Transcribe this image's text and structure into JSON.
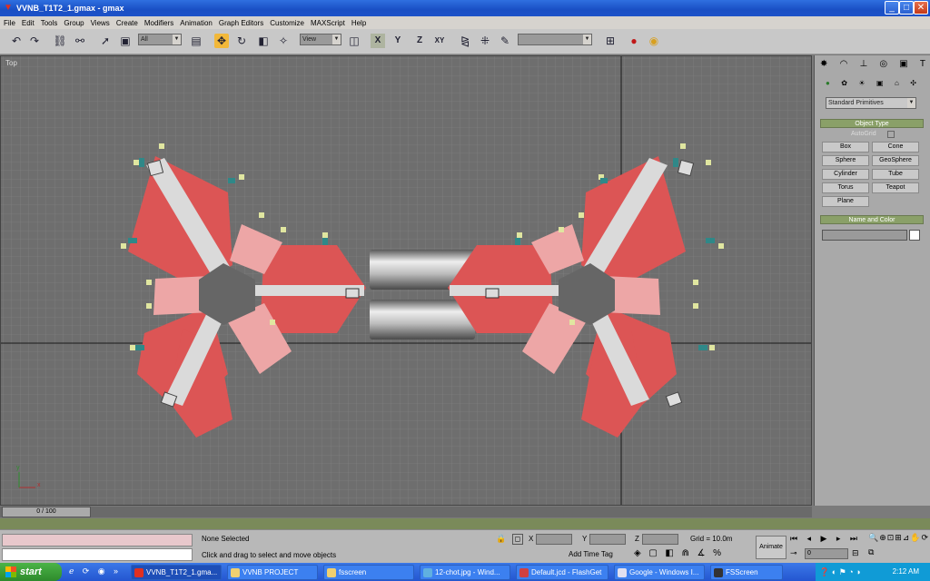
{
  "window": {
    "title": "VVNB_T1T2_1.gmax - gmax",
    "minimize": "_",
    "maximize": "□",
    "close": "✕"
  },
  "menu": [
    "File",
    "Edit",
    "Tools",
    "Group",
    "Views",
    "Create",
    "Modifiers",
    "Animation",
    "Graph Editors",
    "Customize",
    "MAXScript",
    "Help"
  ],
  "toolbar": {
    "selection_filter": "All",
    "coord_system": "View"
  },
  "viewport": {
    "label": "Top",
    "axis_x": "x",
    "axis_y": "y"
  },
  "command_panel": {
    "category": "Standard Primitives",
    "rollout_object_type": "Object Type",
    "autogrid": "AutoGrid",
    "buttons": [
      "Box",
      "Cone",
      "Sphere",
      "GeoSphere",
      "Cylinder",
      "Tube",
      "Torus",
      "Teapot",
      "Plane"
    ],
    "rollout_name_color": "Name and Color"
  },
  "timeline": {
    "slider": "0 / 100"
  },
  "status": {
    "selection": "None Selected",
    "prompt": "Click and drag to select and move objects",
    "x_label": "X",
    "y_label": "Y",
    "z_label": "Z",
    "grid": "Grid = 10.0m",
    "add_time_tag": "Add Time Tag",
    "animate": "Animate",
    "frame": "0"
  },
  "taskbar": {
    "start": "start",
    "tasks": [
      "VVNB_T1T2_1.gma...",
      "VVNB PROJECT",
      "fsscreen",
      "12-chot.jpg - Wind...",
      "Default.jcd - FlashGet",
      "Google - Windows I...",
      "FSScreen"
    ],
    "clock": "2:12 AM"
  }
}
